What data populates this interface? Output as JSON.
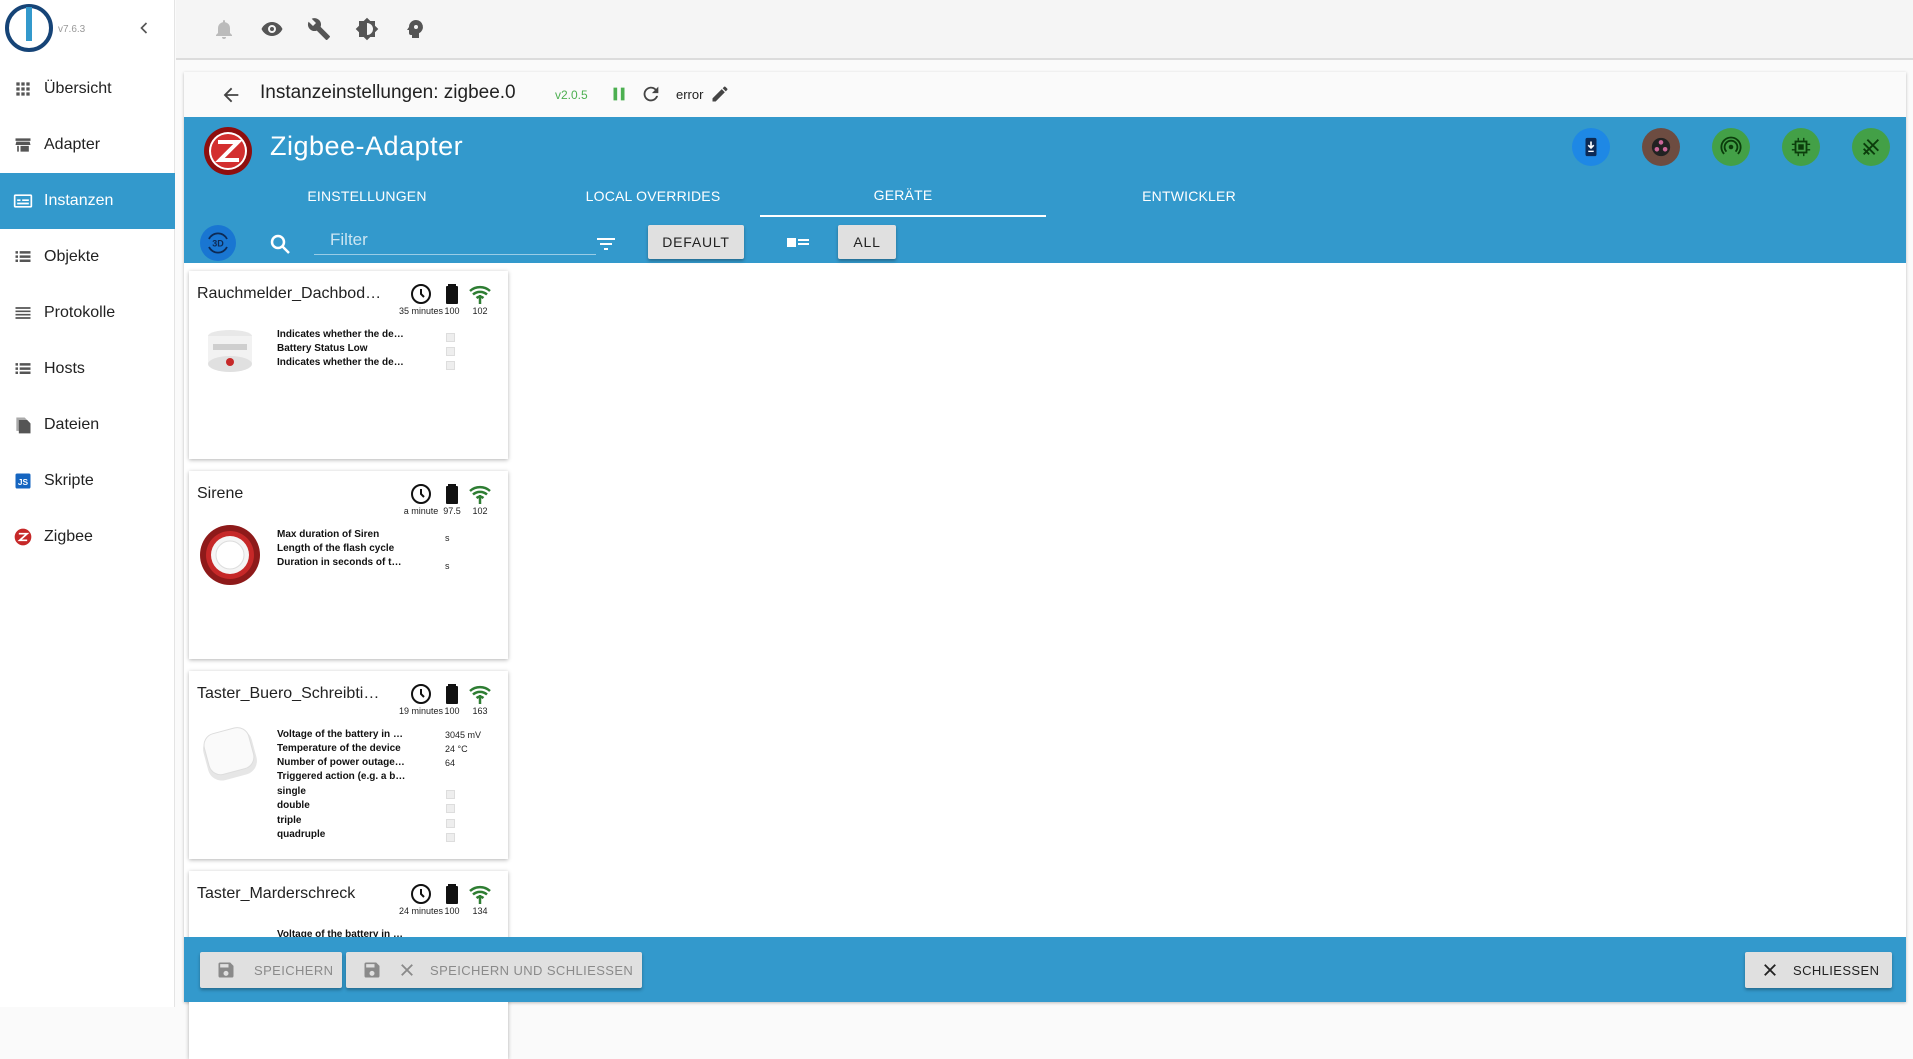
{
  "sidebar": {
    "version": "v7.6.3",
    "items": [
      {
        "label": "Übersicht",
        "icon": "apps-icon"
      },
      {
        "label": "Adapter",
        "icon": "store-icon"
      },
      {
        "label": "Instanzen",
        "icon": "instances-icon",
        "active": true
      },
      {
        "label": "Objekte",
        "icon": "list-icon"
      },
      {
        "label": "Protokolle",
        "icon": "logs-icon"
      },
      {
        "label": "Hosts",
        "icon": "hosts-icon"
      },
      {
        "label": "Dateien",
        "icon": "files-icon"
      },
      {
        "label": "Skripte",
        "icon": "scripts-icon"
      },
      {
        "label": "Zigbee",
        "icon": "zigbee-icon"
      }
    ]
  },
  "toolbar": {
    "icons": [
      "bell-icon",
      "eye-icon",
      "wrench-icon",
      "brightness-icon",
      "expert-head-icon"
    ]
  },
  "instance": {
    "title": "Instanzeinstellungen: zigbee.0",
    "version": "v2.0.5",
    "status": "error"
  },
  "adapter": {
    "title": "Zigbee-Adapter",
    "header_buttons": [
      {
        "icon": "pairing-icon",
        "color": "#1e88e5"
      },
      {
        "icon": "touchlink-icon",
        "color": "#6d4c41"
      },
      {
        "icon": "scan-icon",
        "color": "#43a047"
      },
      {
        "icon": "chip-icon",
        "color": "#43a047"
      },
      {
        "icon": "network-map-icon",
        "color": "#43a047"
      }
    ]
  },
  "tabs": [
    {
      "label": "EINSTELLUNGEN"
    },
    {
      "label": "LOCAL OVERRIDES"
    },
    {
      "label": "GERÄTE",
      "active": true
    },
    {
      "label": "ENTWICKLER"
    }
  ],
  "filter": {
    "three_d_label": "3D",
    "placeholder": "Filter",
    "default_label": "DEFAULT",
    "all_label": "ALL"
  },
  "devices": [
    {
      "name": "Rauchmelder_Dachbod…",
      "last_seen": "35 minutes",
      "battery": "100",
      "link_quality": "102",
      "image": "smoke-detector",
      "props": [
        {
          "label": "Indicates whether the de…",
          "value": "",
          "checkbox": true
        },
        {
          "label": "Battery Status Low",
          "value": "",
          "checkbox": true
        },
        {
          "label": "Indicates whether the de…",
          "value": "",
          "checkbox": true
        }
      ]
    },
    {
      "name": "Sirene",
      "last_seen": "a minute",
      "battery": "97.5",
      "link_quality": "102",
      "image": "siren",
      "props": [
        {
          "label": "Max duration of Siren",
          "value": "s",
          "checkbox": false
        },
        {
          "label": "Length of the flash cycle",
          "value": "",
          "checkbox": false
        },
        {
          "label": "Duration in seconds of t…",
          "value": "s",
          "checkbox": false
        }
      ]
    },
    {
      "name": "Taster_Buero_Schreibti…",
      "last_seen": "19 minutes",
      "battery": "100",
      "link_quality": "163",
      "image": "button",
      "props": [
        {
          "label": "Voltage of the battery in …",
          "value": "3045 mV",
          "checkbox": false
        },
        {
          "label": "Temperature of the device",
          "value": "24 °C",
          "checkbox": false
        },
        {
          "label": "Number of power outage…",
          "value": "64",
          "checkbox": false
        },
        {
          "label": "Triggered action (e.g. a b…",
          "value": "",
          "checkbox": false
        },
        {
          "label": "single",
          "value": "",
          "checkbox": true
        },
        {
          "label": "double",
          "value": "",
          "checkbox": true
        },
        {
          "label": "triple",
          "value": "",
          "checkbox": true
        },
        {
          "label": "quadruple",
          "value": "",
          "checkbox": true
        }
      ]
    },
    {
      "name": "Taster_Marderschreck",
      "last_seen": "24 minutes",
      "battery": "100",
      "link_quality": "134",
      "image": "button",
      "props": [
        {
          "label": "Voltage of the battery in …",
          "value": "",
          "checkbox": false
        }
      ]
    }
  ],
  "footer": {
    "save_label": "SPEICHERN",
    "save_close_label": "SPEICHERN UND SCHLIESSEN",
    "close_label": "SCHLIESSEN"
  }
}
